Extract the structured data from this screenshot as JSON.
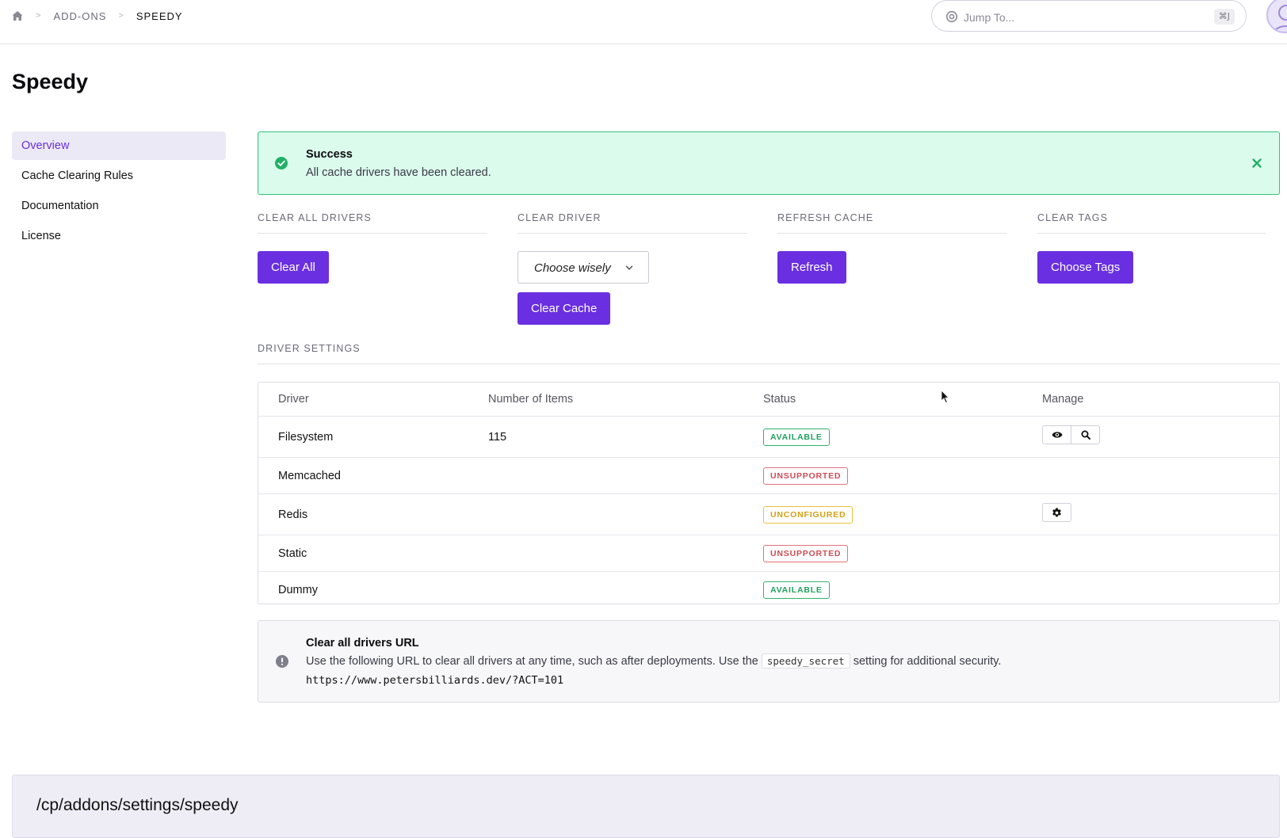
{
  "breadcrumb": {
    "home_icon": "home-icon",
    "separator": ">",
    "items": [
      "ADD-ONS",
      "SPEEDY"
    ]
  },
  "search": {
    "placeholder": "Jump To...",
    "shortcut": "⌘J",
    "icon": "target-icon"
  },
  "page": {
    "title": "Speedy"
  },
  "sidebar": {
    "items": [
      {
        "label": "Overview",
        "active": true
      },
      {
        "label": "Cache Clearing Rules",
        "active": false
      },
      {
        "label": "Documentation",
        "active": false
      },
      {
        "label": "License",
        "active": false
      }
    ]
  },
  "alert": {
    "type": "success",
    "title": "Success",
    "message": "All cache drivers have been cleared.",
    "icon": "check-circle-icon",
    "close_icon": "close-icon"
  },
  "actions": {
    "clear_all": {
      "heading": "CLEAR ALL DRIVERS",
      "button": "Clear All"
    },
    "clear_driver": {
      "heading": "CLEAR DRIVER",
      "select_value": "Choose wisely",
      "button": "Clear Cache"
    },
    "refresh": {
      "heading": "REFRESH CACHE",
      "button": "Refresh"
    },
    "clear_tags": {
      "heading": "CLEAR TAGS",
      "button": "Choose Tags"
    }
  },
  "driver_settings": {
    "heading": "DRIVER SETTINGS",
    "columns": [
      "Driver",
      "Number of Items",
      "Status",
      "Manage"
    ],
    "rows": [
      {
        "driver": "Filesystem",
        "items": "115",
        "status": "AVAILABLE",
        "status_color": "#20a060",
        "manage": [
          "eye-icon",
          "search-icon"
        ]
      },
      {
        "driver": "Memcached",
        "items": "",
        "status": "UNSUPPORTED",
        "status_color": "#d04b56",
        "manage": []
      },
      {
        "driver": "Redis",
        "items": "",
        "status": "UNCONFIGURED",
        "status_color": "#d4a017",
        "manage": [
          "gear-icon"
        ]
      },
      {
        "driver": "Static",
        "items": "",
        "status": "UNSUPPORTED",
        "status_color": "#d04b56",
        "manage": []
      },
      {
        "driver": "Dummy",
        "items": "",
        "status": "AVAILABLE",
        "status_color": "#20a060",
        "manage": []
      }
    ]
  },
  "info": {
    "icon": "alert-circle-icon",
    "title": "Clear all drivers URL",
    "text_before": "Use the following URL to clear all drivers at any time, such as after deployments. Use the",
    "code": "speedy_secret",
    "text_after": "setting for additional security.",
    "url": "https://www.petersbilliards.dev/?ACT=101"
  },
  "route": {
    "path": "/cp/addons/settings/speedy"
  },
  "colors": {
    "accent": "#6a2fe0",
    "success_bg": "#dbfbec",
    "success_border": "#32c57c"
  }
}
